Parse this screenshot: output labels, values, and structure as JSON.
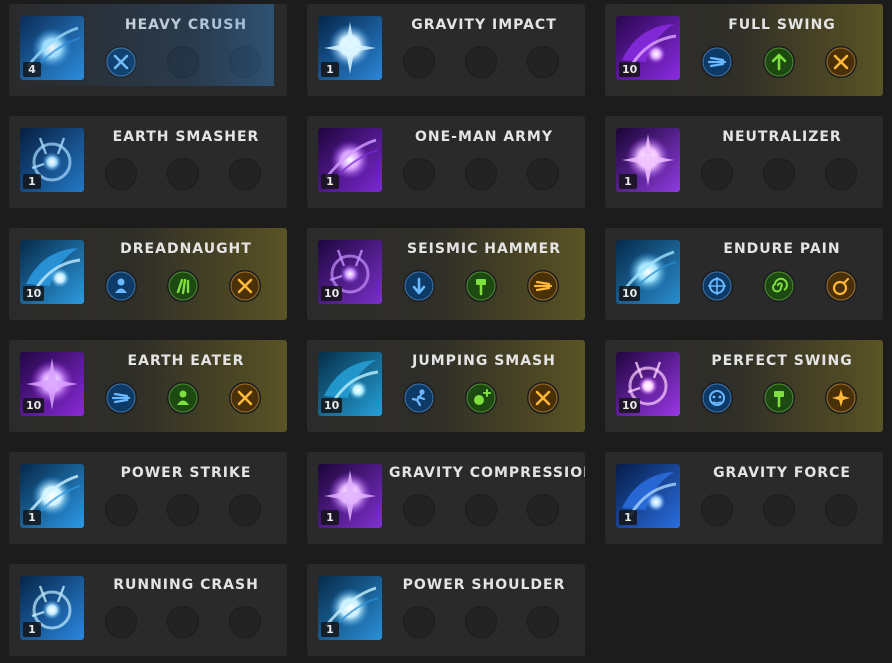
{
  "skills": [
    {
      "name": "HEAVY CRUSH",
      "level": "4",
      "icon": "heavy-crush-icon",
      "theme": [
        "#0a2a55",
        "#2c8fe0",
        "#9fe0ff"
      ],
      "card": "blueglow",
      "tripods": [
        {
          "icon": "crossed-blades-tripod-icon",
          "colors": [
            "#0d3a66",
            "#7fc8ff"
          ]
        },
        null,
        null
      ]
    },
    {
      "name": "GRAVITY IMPACT",
      "level": "1",
      "icon": "gravity-impact-icon",
      "theme": [
        "#06254a",
        "#2a86d8",
        "#d8f4ff"
      ],
      "card": "",
      "tripods": [
        null,
        null,
        null
      ]
    },
    {
      "name": "FULL SWING",
      "level": "10",
      "icon": "full-swing-icon",
      "theme": [
        "#2a0650",
        "#8a2be2",
        "#e0a8ff"
      ],
      "card": "gold",
      "tripods": [
        {
          "icon": "speed-lines-tripod-icon",
          "colors": [
            "#0d3a66",
            "#6ab8ff"
          ]
        },
        {
          "icon": "up-arrow-tripod-icon",
          "colors": [
            "#1d4a10",
            "#7fe040"
          ]
        },
        {
          "icon": "crossed-blades-tripod-icon",
          "colors": [
            "#4a3006",
            "#ffb838"
          ]
        }
      ]
    },
    {
      "name": "EARTH SMASHER",
      "level": "1",
      "icon": "earth-smasher-icon",
      "theme": [
        "#061e40",
        "#2478c8",
        "#a8dcff"
      ],
      "card": "",
      "tripods": [
        null,
        null,
        null
      ]
    },
    {
      "name": "ONE-MAN ARMY",
      "level": "1",
      "icon": "one-man-army-icon",
      "theme": [
        "#20063f",
        "#7a28d0",
        "#d69cff"
      ],
      "card": "",
      "tripods": [
        null,
        null,
        null
      ]
    },
    {
      "name": "NEUTRALIZER",
      "level": "1",
      "icon": "neutralizer-icon",
      "theme": [
        "#1a0535",
        "#8f3be0",
        "#f0c0ff"
      ],
      "card": "",
      "tripods": [
        null,
        null,
        null
      ]
    },
    {
      "name": "DREADNAUGHT",
      "level": "10",
      "icon": "dreadnaught-icon",
      "theme": [
        "#072a4a",
        "#2c9ae0",
        "#bfeaff"
      ],
      "card": "gold",
      "tripods": [
        {
          "icon": "person-shield-tripod-icon",
          "colors": [
            "#0d3a66",
            "#6ab8ff"
          ]
        },
        {
          "icon": "claw-tripod-icon",
          "colors": [
            "#1d4a10",
            "#7fe040"
          ]
        },
        {
          "icon": "crossed-blades-tripod-icon",
          "colors": [
            "#4a3006",
            "#ffb838"
          ]
        }
      ]
    },
    {
      "name": "SEISMIC HAMMER",
      "level": "10",
      "icon": "seismic-hammer-icon",
      "theme": [
        "#1e0640",
        "#7a30c8",
        "#c890ff"
      ],
      "card": "gold",
      "tripods": [
        {
          "icon": "down-arrow-tripod-icon",
          "colors": [
            "#0d3a66",
            "#6ab8ff"
          ]
        },
        {
          "icon": "hammer-tripod-icon",
          "colors": [
            "#1d4a10",
            "#7fe040"
          ]
        },
        {
          "icon": "speed-lines-tripod-icon",
          "colors": [
            "#4a3006",
            "#ffb838"
          ]
        }
      ]
    },
    {
      "name": "ENDURE PAIN",
      "level": "10",
      "icon": "endure-pain-icon",
      "theme": [
        "#062a4a",
        "#2a8ed0",
        "#a0e4ff"
      ],
      "card": "",
      "tripods": [
        {
          "icon": "target-tripod-icon",
          "colors": [
            "#0d3a66",
            "#6ab8ff"
          ]
        },
        {
          "icon": "spiral-tripod-icon",
          "colors": [
            "#1d4a10",
            "#7fe040"
          ]
        },
        {
          "icon": "bomb-tripod-icon",
          "colors": [
            "#4a3006",
            "#ffb838"
          ]
        }
      ]
    },
    {
      "name": "EARTH EATER",
      "level": "10",
      "icon": "earth-eater-icon",
      "theme": [
        "#220645",
        "#8a2ad8",
        "#d8a0ff"
      ],
      "card": "gold",
      "tripods": [
        {
          "icon": "speed-lines-tripod-icon",
          "colors": [
            "#0d3a66",
            "#6ab8ff"
          ]
        },
        {
          "icon": "person-shield-tripod-icon",
          "colors": [
            "#1d4a10",
            "#7fe040"
          ]
        },
        {
          "icon": "crossed-blades-tripod-icon",
          "colors": [
            "#4a3006",
            "#ffb838"
          ]
        }
      ]
    },
    {
      "name": "JUMPING SMASH",
      "level": "10",
      "icon": "jumping-smash-icon",
      "theme": [
        "#062e48",
        "#26a0d8",
        "#b8f0ff"
      ],
      "card": "gold",
      "tripods": [
        {
          "icon": "running-figure-tripod-icon",
          "colors": [
            "#0d3a66",
            "#6ab8ff"
          ]
        },
        {
          "icon": "plus-orb-tripod-icon",
          "colors": [
            "#1d4a10",
            "#7fe040"
          ]
        },
        {
          "icon": "crossed-blades-tripod-icon",
          "colors": [
            "#4a3006",
            "#ffb838"
          ]
        }
      ]
    },
    {
      "name": "PERFECT SWING",
      "level": "10",
      "icon": "perfect-swing-icon",
      "theme": [
        "#200540",
        "#9a38e8",
        "#ffd0ff"
      ],
      "card": "gold",
      "tripods": [
        {
          "icon": "face-tripod-icon",
          "colors": [
            "#0d3a66",
            "#6ab8ff"
          ]
        },
        {
          "icon": "hammer-tripod-icon",
          "colors": [
            "#1d4a10",
            "#7fe040"
          ]
        },
        {
          "icon": "burst-tripod-icon",
          "colors": [
            "#4a3006",
            "#ffb838"
          ]
        }
      ]
    },
    {
      "name": "POWER STRIKE",
      "level": "1",
      "icon": "power-strike-icon",
      "theme": [
        "#062848",
        "#2c9ae8",
        "#d0f4ff"
      ],
      "card": "",
      "tripods": [
        null,
        null,
        null
      ]
    },
    {
      "name": "GRAVITY COMPRESSION",
      "level": "1",
      "icon": "gravity-compression-icon",
      "theme": [
        "#1c0538",
        "#8030d0",
        "#e0b0ff"
      ],
      "card": "",
      "tripods": [
        null,
        null,
        null
      ]
    },
    {
      "name": "GRAVITY FORCE",
      "level": "1",
      "icon": "gravity-force-icon",
      "theme": [
        "#061c48",
        "#2a6ee0",
        "#a8d4ff"
      ],
      "card": "",
      "tripods": [
        null,
        null,
        null
      ]
    },
    {
      "name": "RUNNING CRASH",
      "level": "1",
      "icon": "running-crash-icon",
      "theme": [
        "#062448",
        "#2a88e0",
        "#c0ecff"
      ],
      "card": "",
      "tripods": [
        null,
        null,
        null
      ]
    },
    {
      "name": "POWER SHOULDER",
      "level": "1",
      "icon": "power-shoulder-icon",
      "theme": [
        "#062a4a",
        "#2a90d8",
        "#c8f0ff"
      ],
      "card": "",
      "tripods": [
        null,
        null,
        null
      ]
    }
  ]
}
